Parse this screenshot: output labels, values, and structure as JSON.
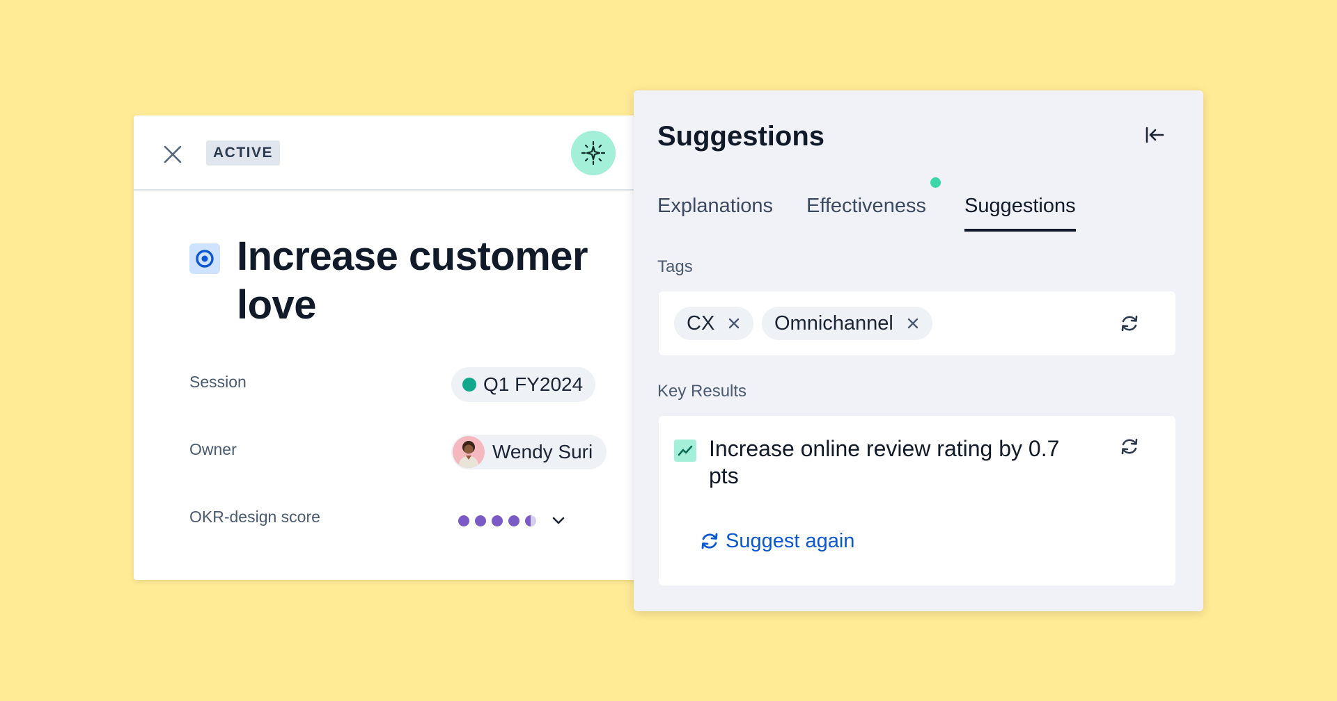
{
  "objective": {
    "status": "ACTIVE",
    "title": "Increase customer love",
    "fields": {
      "session_label": "Session",
      "session_value": "Q1 FY2024",
      "owner_label": "Owner",
      "owner_value": "Wendy Suri",
      "score_label": "OKR-design score",
      "score_value": 4.5,
      "score_max": 5
    }
  },
  "panel": {
    "title": "Suggestions",
    "tabs": [
      {
        "label": "Explanations"
      },
      {
        "label": "Effectiveness"
      },
      {
        "label": "Suggestions"
      }
    ],
    "tags_label": "Tags",
    "tags": [
      "CX",
      "Omnichannel"
    ],
    "key_results_label": "Key Results",
    "key_result_text": "Increase online review rating by 0.7 pts",
    "suggest_again_label": "Suggest again"
  },
  "colors": {
    "background": "#FFEB95",
    "accent_teal": "#A3EFD8",
    "session_status": "#12A88C",
    "score": "#7A5BC6",
    "link": "#0B57D0"
  },
  "icons": [
    "close-icon",
    "sparkle-icon",
    "target-icon",
    "collapse-left-icon",
    "refresh-icon",
    "trend-up-icon",
    "chevron-down-icon"
  ]
}
